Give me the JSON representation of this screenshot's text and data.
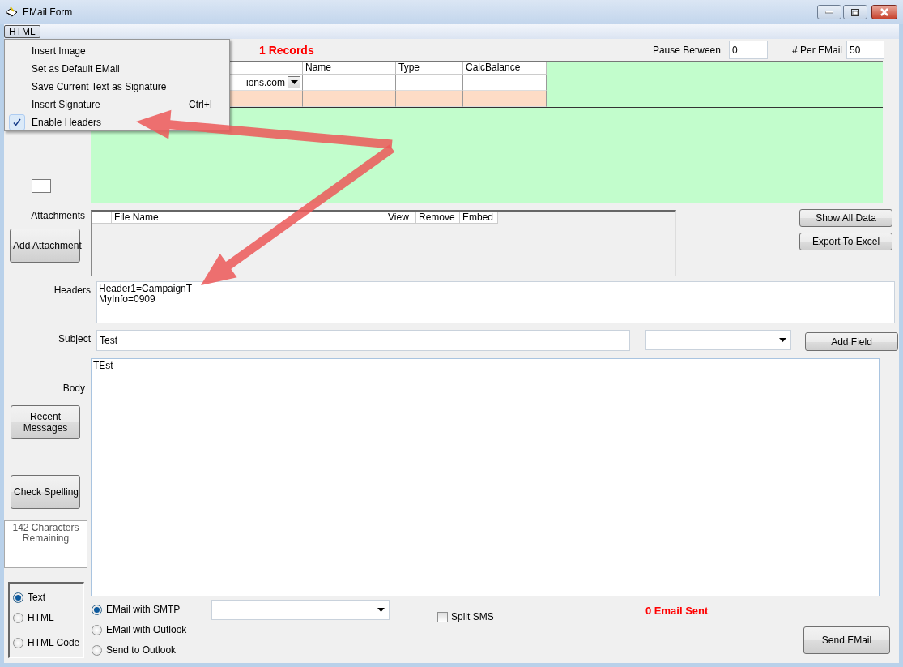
{
  "window": {
    "title": "EMail Form"
  },
  "menu_bar": [
    {
      "label": "HTML",
      "selected": true
    }
  ],
  "open_menu": {
    "items": [
      {
        "label": "Insert Image",
        "checked": false
      },
      {
        "label": "Set as Default EMail",
        "checked": false
      },
      {
        "label": "Save Current Text as Signature",
        "checked": false
      },
      {
        "label": "Insert Signature",
        "shortcut": "Ctrl+I",
        "checked": false
      },
      {
        "label": "Enable Headers",
        "checked": true
      }
    ]
  },
  "records_label": "1 Records",
  "pause_between": {
    "label": "Pause Between",
    "value": "0"
  },
  "per_email": {
    "label": "# Per EMail",
    "value": "50"
  },
  "data_grid": {
    "columns": [
      "Name",
      "Type",
      "CalcBalance"
    ],
    "rows": [
      {
        "kind": "data",
        "email": "ions.com"
      },
      {
        "kind": "new"
      }
    ]
  },
  "attachments": {
    "label": "Attachments",
    "columns": [
      "File Name",
      "View",
      "Remove",
      "Embed"
    ]
  },
  "add_attachment_button": "Add Attachment",
  "show_all_data_button": "Show All Data",
  "export_to_excel_button": "Export To Excel",
  "headers": {
    "label": "Headers",
    "value": "Header1=CampaignT\nMyInfo=0909"
  },
  "subject": {
    "label": "Subject",
    "value": "Test"
  },
  "add_field_button": "Add Field",
  "body": {
    "label": "Body",
    "value": "TEst"
  },
  "recent_messages_button": "Recent Messages",
  "check_spelling_button": "Check Spelling",
  "characters_remaining": "142 Characters Remaining",
  "format_options": [
    {
      "label": "Text",
      "selected": true
    },
    {
      "label": "HTML",
      "selected": false
    },
    {
      "label": "HTML Code",
      "selected": false
    }
  ],
  "send_methods": [
    {
      "label": "EMail with SMTP",
      "selected": true
    },
    {
      "label": "EMail with Outlook",
      "selected": false
    },
    {
      "label": "Send to Outlook",
      "selected": false
    }
  ],
  "split_sms": {
    "label": "Split SMS",
    "checked": false
  },
  "sent_status": "0 Email Sent",
  "send_button": "Send EMail"
}
